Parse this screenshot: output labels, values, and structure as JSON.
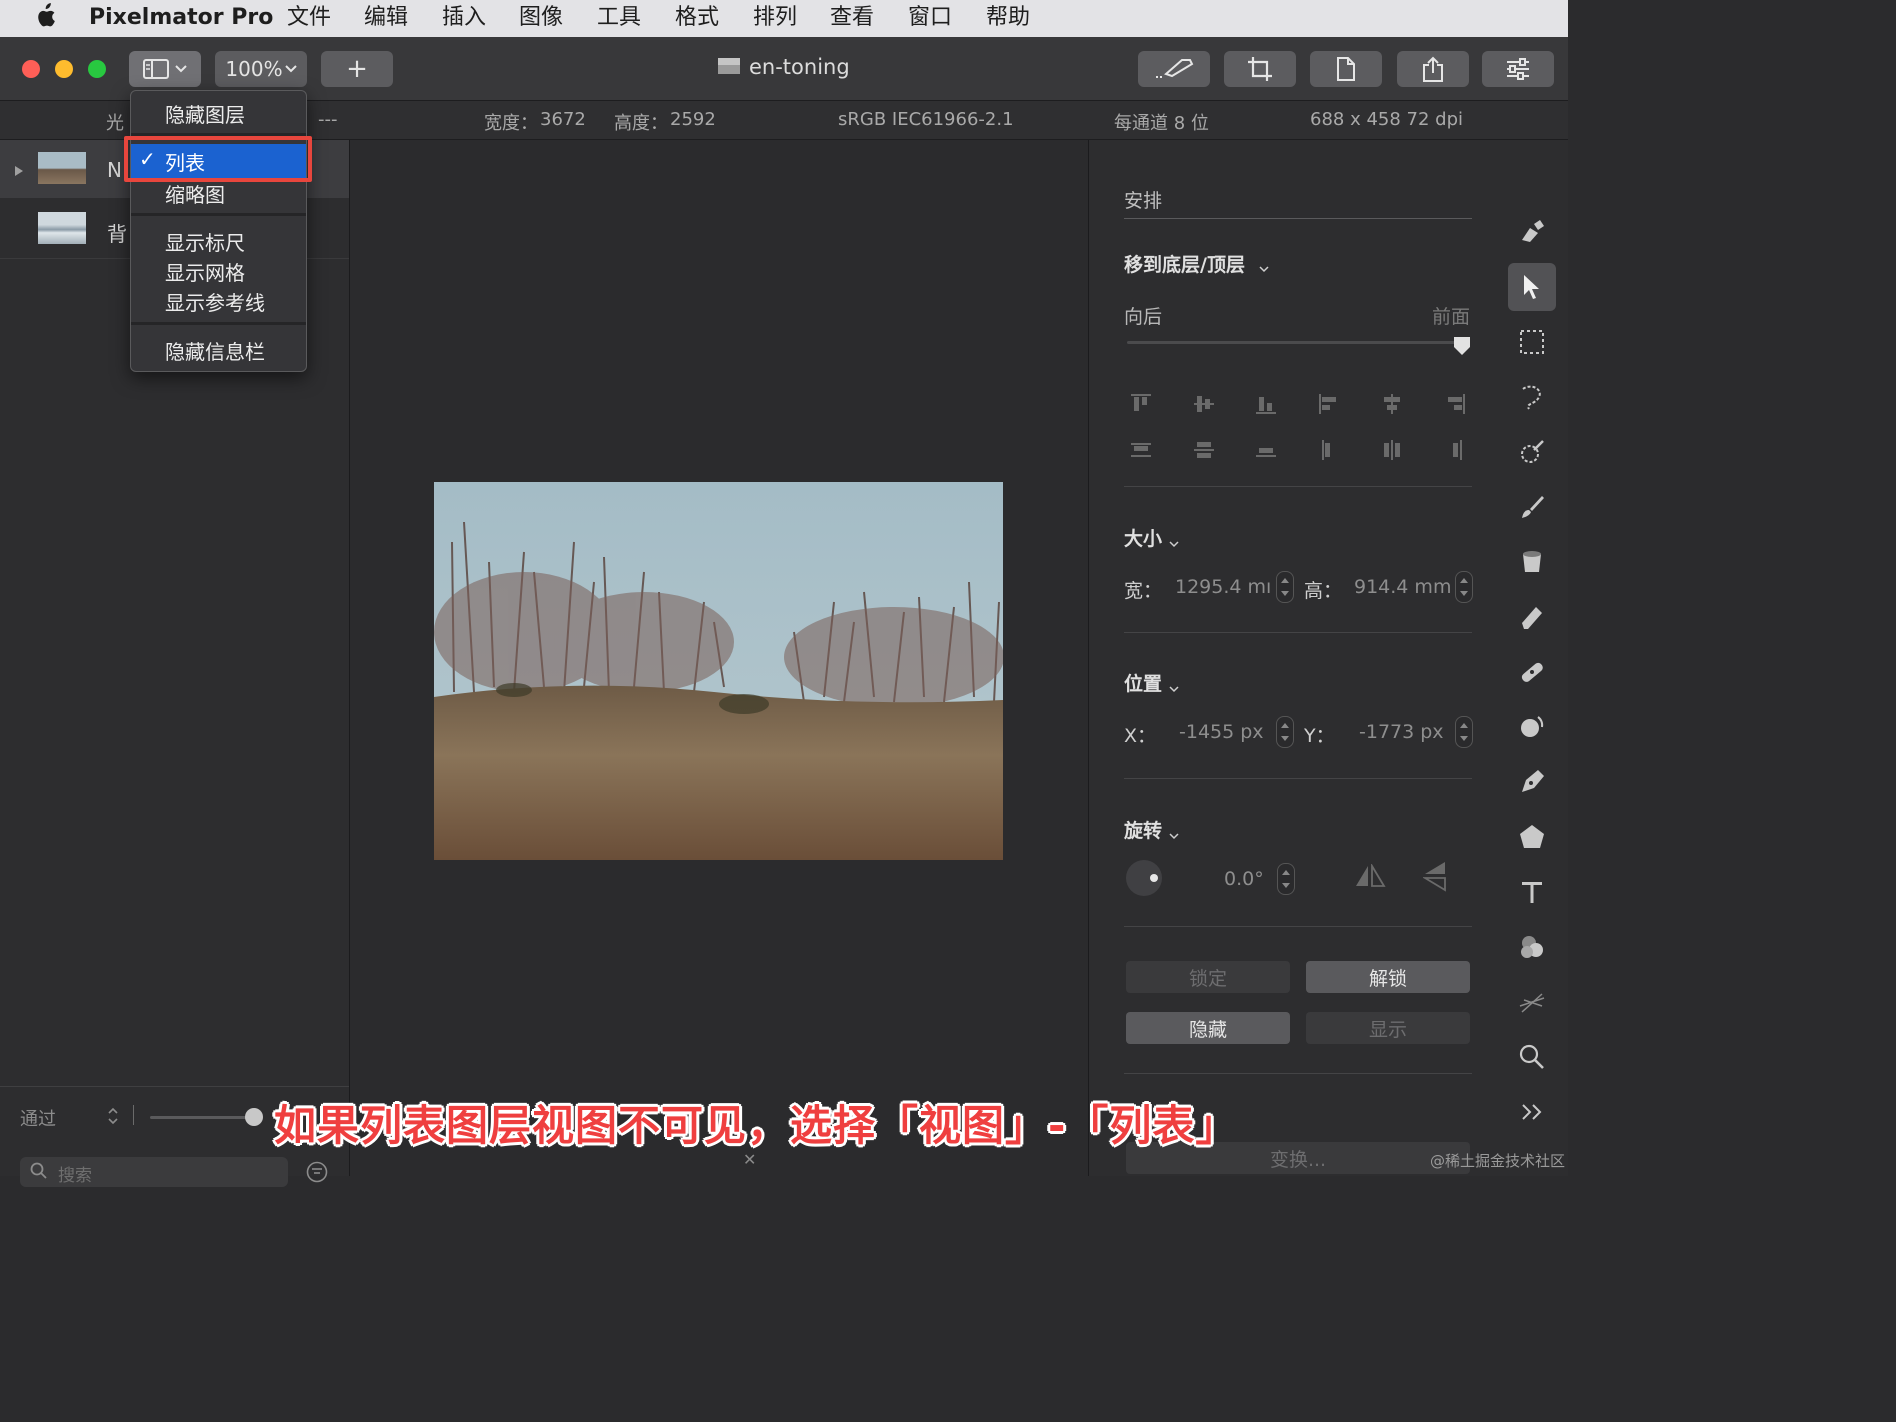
{
  "menubar": {
    "app": "Pixelmator Pro",
    "items": [
      "文件",
      "编辑",
      "插入",
      "图像",
      "工具",
      "格式",
      "排列",
      "查看",
      "窗口",
      "帮助"
    ]
  },
  "toolbar": {
    "zoom": "100%",
    "add_label": "+",
    "doc_title": "en-toning"
  },
  "infobar": {
    "left_label": "光",
    "dashes": "---",
    "width_label": "宽度：",
    "width_value": "3672",
    "height_label": "高度：",
    "height_value": "2592",
    "color_profile": "sRGB IEC61966-2.1",
    "bit_depth": "每通道 8 位",
    "resolution": "688 x 458 72 dpi"
  },
  "layers": [
    {
      "name": "N"
    },
    {
      "name": "背"
    }
  ],
  "dropdown": {
    "items": [
      "隐藏图层",
      "列表",
      "缩略图",
      "显示标尺",
      "显示网格",
      "显示参考线",
      "隐藏信息栏"
    ],
    "checked": "✓"
  },
  "leftbottom": {
    "blend": "通过",
    "search_placeholder": "搜索"
  },
  "arrange": {
    "title": "安排",
    "move_label": "移到底层/顶层",
    "back_label": "向后",
    "front_label": "前面",
    "slider_value": 1.0
  },
  "size": {
    "title": "大小",
    "w_label": "宽：",
    "w_value": "1295.4 mı",
    "h_label": "高：",
    "h_value": "914.4 mm"
  },
  "position": {
    "title": "位置",
    "x_label": "X：",
    "x_value": "-1455 px",
    "y_label": "Y：",
    "y_value": "-1773 px"
  },
  "rotate": {
    "title": "旋转",
    "value": "0.0°"
  },
  "buttons": {
    "lock": "锁定",
    "unlock": "解锁",
    "hide": "隐藏",
    "show": "显示",
    "transform": "变换..."
  },
  "caption": "如果列表图层视图不可见，选择「视图」-「列表」",
  "watermark": "@稀土掘金技术社区",
  "colors": {
    "accent": "#1b62d0",
    "highlight_box": "#e8463d",
    "caption": "#ef3f3f"
  }
}
